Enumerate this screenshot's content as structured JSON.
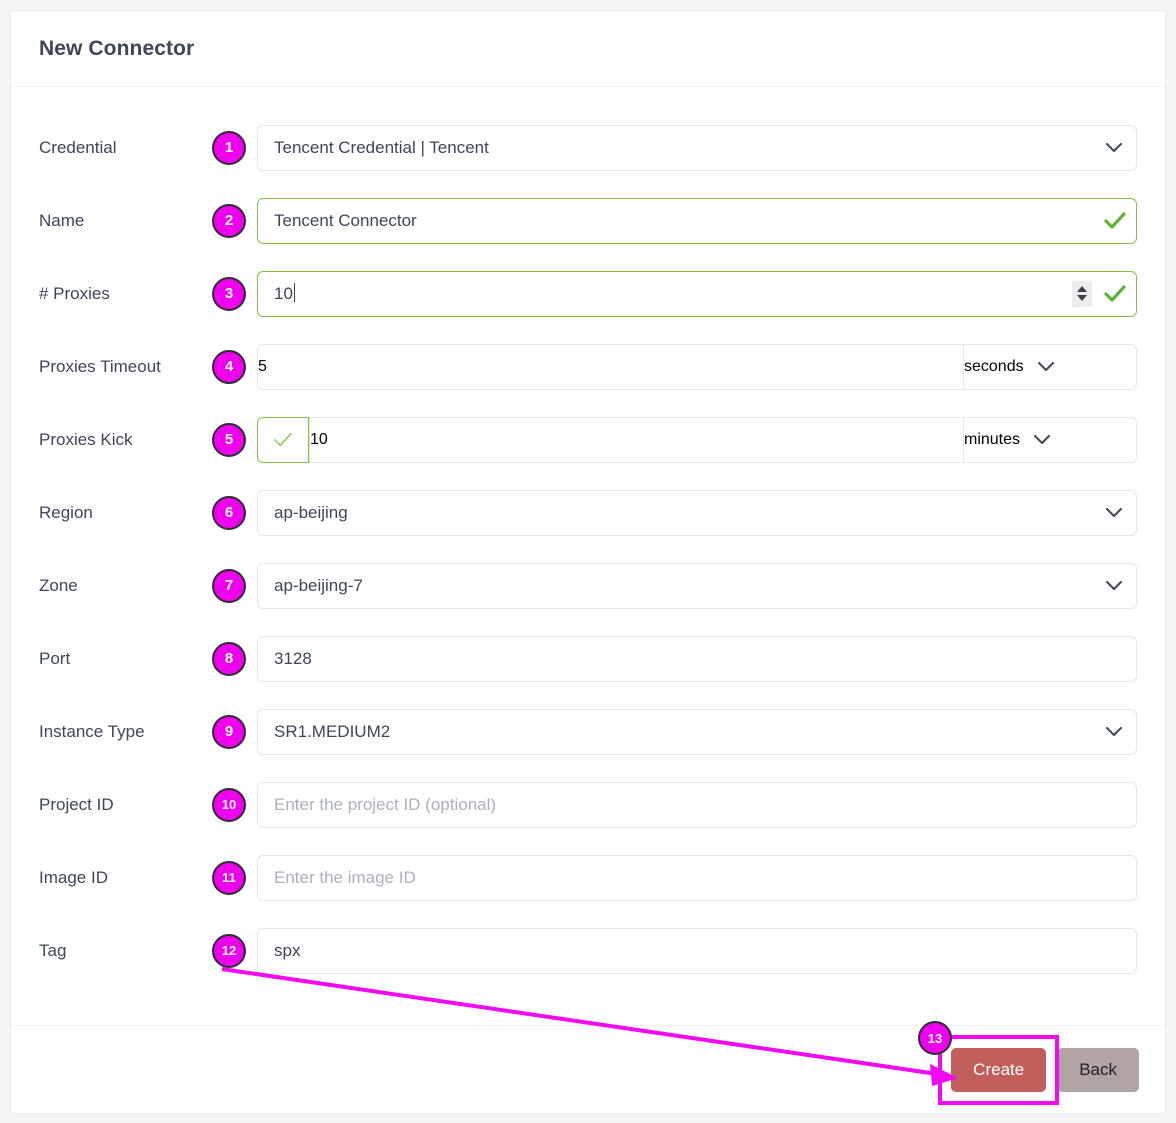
{
  "header": {
    "title": "New Connector"
  },
  "form": {
    "rows": [
      {
        "badge": "1",
        "label": "Credential",
        "value": "Tencent Credential | Tencent",
        "type": "select",
        "valid": false,
        "placeholder": ""
      },
      {
        "badge": "2",
        "label": "Name",
        "value": "Tencent Connector",
        "type": "text-valid",
        "valid": true,
        "placeholder": ""
      },
      {
        "badge": "3",
        "label": "# Proxies",
        "value": "10",
        "type": "number-valid",
        "valid": true,
        "placeholder": ""
      },
      {
        "badge": "4",
        "label": "Proxies Timeout",
        "value": "5",
        "type": "split",
        "unit": "seconds",
        "valid": false,
        "placeholder": ""
      },
      {
        "badge": "5",
        "label": "Proxies Kick",
        "value": "10",
        "type": "split-check",
        "unit": "minutes",
        "valid": true,
        "placeholder": ""
      },
      {
        "badge": "6",
        "label": "Region",
        "value": "ap-beijing",
        "type": "select",
        "valid": false,
        "placeholder": ""
      },
      {
        "badge": "7",
        "label": "Zone",
        "value": "ap-beijing-7",
        "type": "select",
        "valid": false,
        "placeholder": ""
      },
      {
        "badge": "8",
        "label": "Port",
        "value": "3128",
        "type": "text",
        "valid": false,
        "placeholder": ""
      },
      {
        "badge": "9",
        "label": "Instance Type",
        "value": "SR1.MEDIUM2",
        "type": "select",
        "valid": false,
        "placeholder": ""
      },
      {
        "badge": "10",
        "label": "Project ID",
        "value": "",
        "type": "text",
        "valid": false,
        "placeholder": "Enter the project ID (optional)"
      },
      {
        "badge": "11",
        "label": "Image ID",
        "value": "",
        "type": "text",
        "valid": false,
        "placeholder": "Enter the image ID"
      },
      {
        "badge": "12",
        "label": "Tag",
        "value": "spx",
        "type": "text",
        "valid": false,
        "placeholder": ""
      }
    ]
  },
  "footer": {
    "create_label": "Create",
    "back_label": "Back",
    "create_badge": "13"
  },
  "colors": {
    "badge_fill": "#ee00ee",
    "annotation": "#f209f2",
    "valid_border": "#84c341",
    "create_bg": "#c05f5c",
    "back_bg": "#b3a4a4",
    "label_text": "#3c4759",
    "page_bg": "#f4f5f7"
  }
}
